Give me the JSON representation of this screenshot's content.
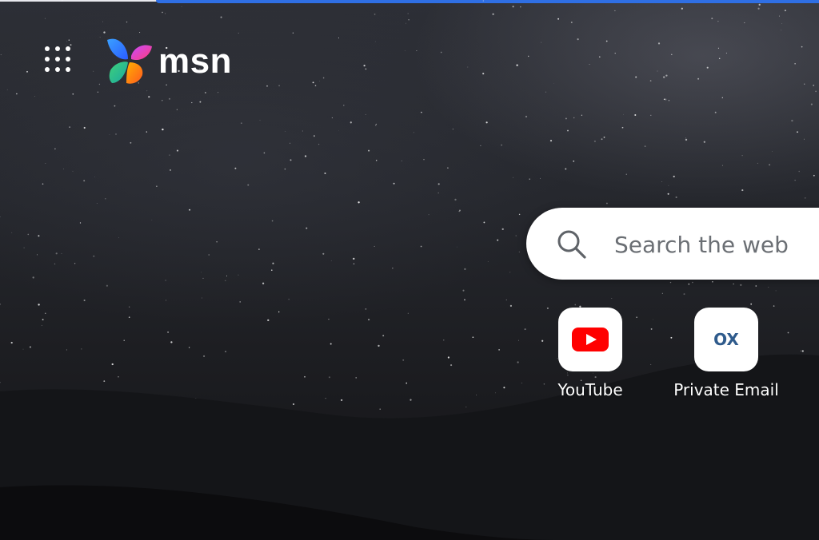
{
  "header": {
    "apps_menu_icon": "apps-grid-icon",
    "logo_icon": "msn-butterfly-icon",
    "logo_text": "msn"
  },
  "search": {
    "icon": "search-icon",
    "placeholder": "Search the web",
    "value": ""
  },
  "quick_links": [
    {
      "label": "YouTube",
      "icon": "youtube-icon",
      "color": "#ff0000"
    },
    {
      "label": "Private Email",
      "icon": "ox-icon",
      "icon_text": "OX",
      "color": "#2f5b8c"
    }
  ],
  "colors": {
    "top_accent": "#2f6fe4",
    "background": "#1d1e22",
    "search_background": "#ffffff"
  }
}
